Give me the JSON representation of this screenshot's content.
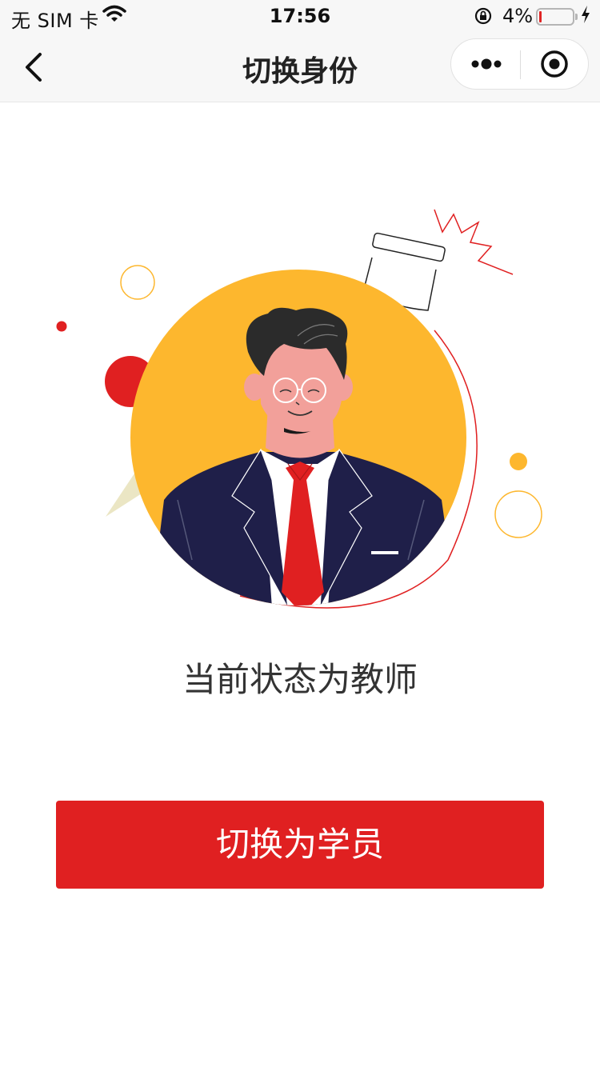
{
  "status_bar": {
    "carrier": "无 SIM 卡",
    "time": "17:56",
    "battery": "4%"
  },
  "nav": {
    "title": "切换身份"
  },
  "content": {
    "status_text": "当前状态为教师",
    "switch_button": "切换为学员"
  },
  "colors": {
    "accent": "#e02021",
    "yellow": "#fdb72e",
    "suit": "#1f1f49"
  },
  "icons": [
    "wifi-icon",
    "rotation-lock-icon",
    "battery-icon",
    "charging-bolt-icon",
    "back-arrow-icon",
    "more-dots-icon",
    "target-icon"
  ]
}
